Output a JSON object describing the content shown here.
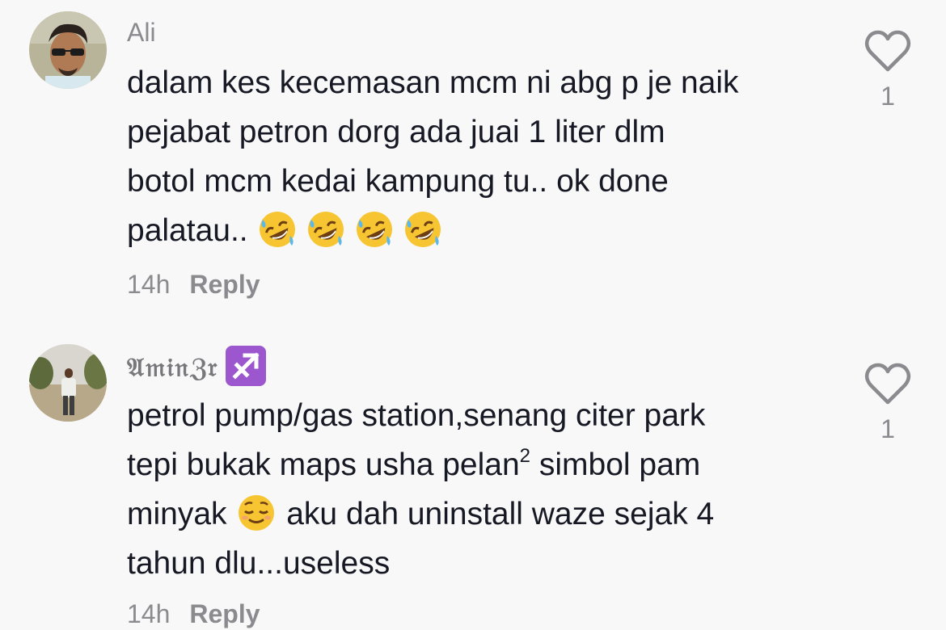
{
  "comments": [
    {
      "username": "Ali",
      "text_lines": [
        "dalam kes kecemasan mcm ni abg p je naik",
        "pejabat petron dorg ada juai 1 liter dlm",
        "botol mcm kedai kampung tu.. ok done",
        "palatau.."
      ],
      "emojis": [
        "rolling-on-floor-laughing",
        "rolling-on-floor-laughing",
        "rolling-on-floor-laughing",
        "rolling-on-floor-laughing"
      ],
      "time": "14h",
      "reply_label": "Reply",
      "likes": "1"
    },
    {
      "username": "𝔄𝔪𝔦𝔫ℨ𝔯",
      "badge_icon": "sagittarius-icon",
      "text_parts": {
        "line1": "petrol pump/gas station,senang citer park",
        "line2_a": "tepi bukak maps usha pelan",
        "line2_sup": "2",
        "line2_b": " simbol pam",
        "line3_a": "minyak",
        "line3_emoji": "relieved-face",
        "line3_b": " aku dah uninstall waze sejak 4",
        "line4": "tahun dlu...useless"
      },
      "time": "14h",
      "reply_label": "Reply",
      "likes": "1"
    }
  ],
  "colors": {
    "background": "#f8f8f8",
    "text": "#161823",
    "muted": "#8a8a8f",
    "badge": "#9c57cf"
  }
}
